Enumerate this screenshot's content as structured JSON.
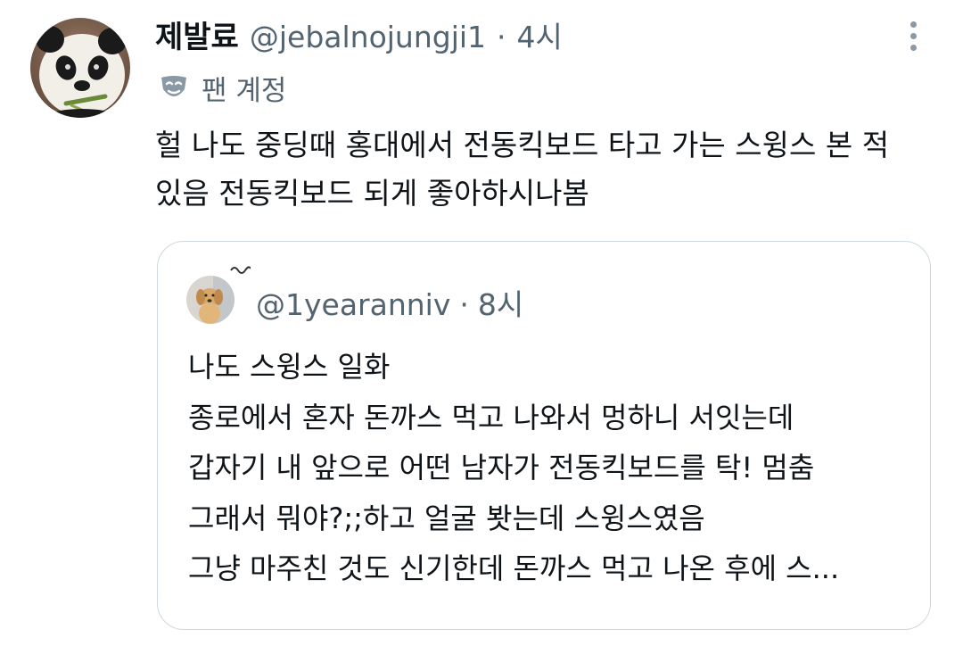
{
  "tweet": {
    "author_name": "제발료",
    "author_handle": "@jebalnojungji1",
    "separator": "·",
    "time": "4시",
    "badge_icon": "theater-mask-icon",
    "badge_label": "팬 계정",
    "more_icon": "more-vertical-icon",
    "text_lines": [
      "헐 나도 중딩때 홍대에서 전동킥보드 타고 가는 스윙스 본 적",
      "있음 전동킥보드 되게 좋아하시나봄"
    ]
  },
  "quoted": {
    "handle": "@1yearanniv",
    "separator": "·",
    "time": "8시",
    "avatar_icon": "puppy-avatar",
    "lines": [
      "나도 스윙스 일화",
      "종로에서 혼자 돈까스 먹고 나와서 멍하니 서잇는데",
      "갑자기 내 앞으로 어떤 남자가 전동킥보드를 탁! 멈춤",
      "그래서 뭐야?;;하고 얼굴 봣는데 스윙스였음",
      "그냥 마주친 것도 신기한데 돈까스 먹고 나온 후에 스..."
    ]
  },
  "colors": {
    "text_primary": "#0f1419",
    "text_secondary": "#536471",
    "border": "#cfd9de"
  }
}
